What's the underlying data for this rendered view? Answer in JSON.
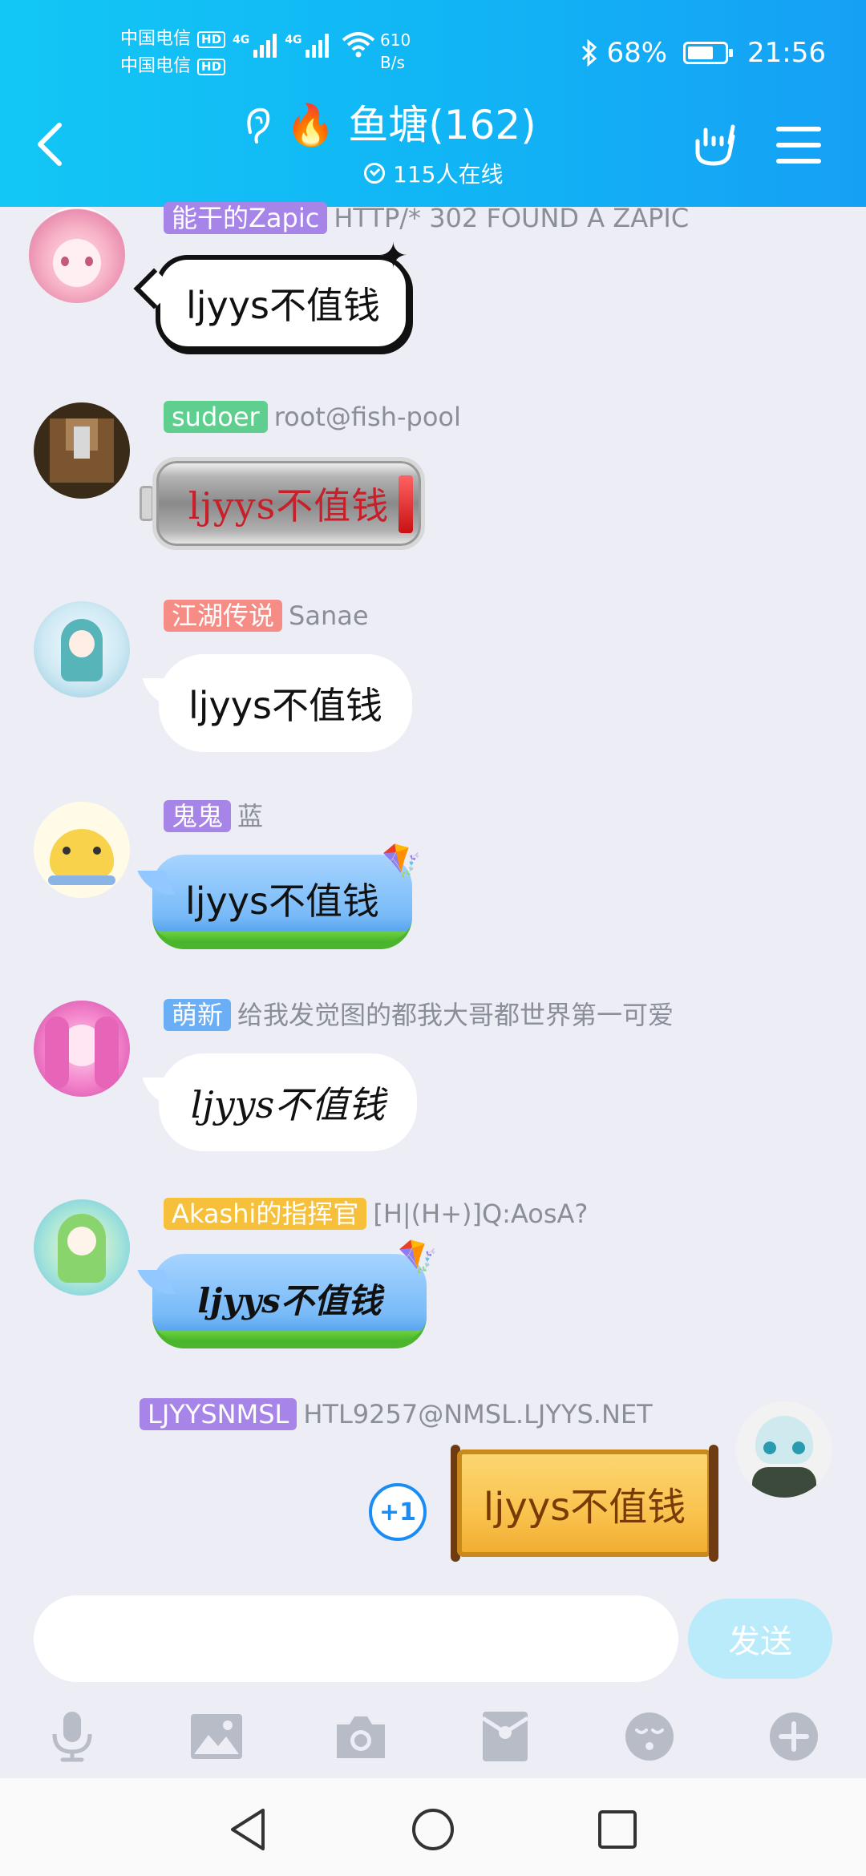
{
  "status_bar": {
    "carrier1": "中国电信",
    "carrier2": "中国电信",
    "hd": "HD",
    "net_tag": "4G",
    "net_speed_value": "610",
    "net_speed_unit": "B/s",
    "battery": "68%",
    "time": "21:56"
  },
  "header": {
    "title": "鱼塘(162)",
    "online": "115人在线"
  },
  "messages": [
    {
      "badge": "能干的Zapic",
      "badge_color": "#a785e8",
      "nickname": "HTTP/* 302 FOUND A ZAPIC",
      "text": "ljyys不值钱",
      "style": "comic"
    },
    {
      "badge": "sudoer",
      "badge_color": "#5fcf8f",
      "nickname": "root@fish-pool",
      "text": "ljyys不值钱",
      "style": "battery"
    },
    {
      "badge": "江湖传说",
      "badge_color": "#f58d86",
      "nickname": "Sanae",
      "text": "ljyys不值钱",
      "style": "plain"
    },
    {
      "badge": "鬼鬼",
      "badge_color": "#a785e8",
      "nickname": "蓝",
      "text": "ljyys不值钱",
      "style": "sky"
    },
    {
      "badge": "萌新",
      "badge_color": "#6aaef6",
      "nickname": "给我发觉图的都我大哥都世界第一可爱",
      "text": "ljyys不值钱",
      "style": "plain-script"
    },
    {
      "badge": "Akashi的指挥官",
      "badge_color": "#f7c03a",
      "nickname": "[H|(H+)]Q:AosA?",
      "text": "ljyys不值钱",
      "style": "sky-script"
    },
    {
      "badge": "LJYYSNMSL",
      "badge_color": "#a785e8",
      "nickname": "HTL9257@NMSL.LJYYS.NET",
      "text": "ljyys不值钱",
      "style": "scroll",
      "plus_one": "+1"
    }
  ],
  "input": {
    "placeholder": "",
    "value": ""
  },
  "send_label": "发送",
  "toolbar_icons": [
    "microphone-icon",
    "image-icon",
    "camera-icon",
    "red-packet-icon",
    "emoji-icon",
    "plus-icon"
  ],
  "colors": {
    "header": "#12b6f5",
    "background": "#edeef5",
    "send_button": "#b9ebfb"
  }
}
